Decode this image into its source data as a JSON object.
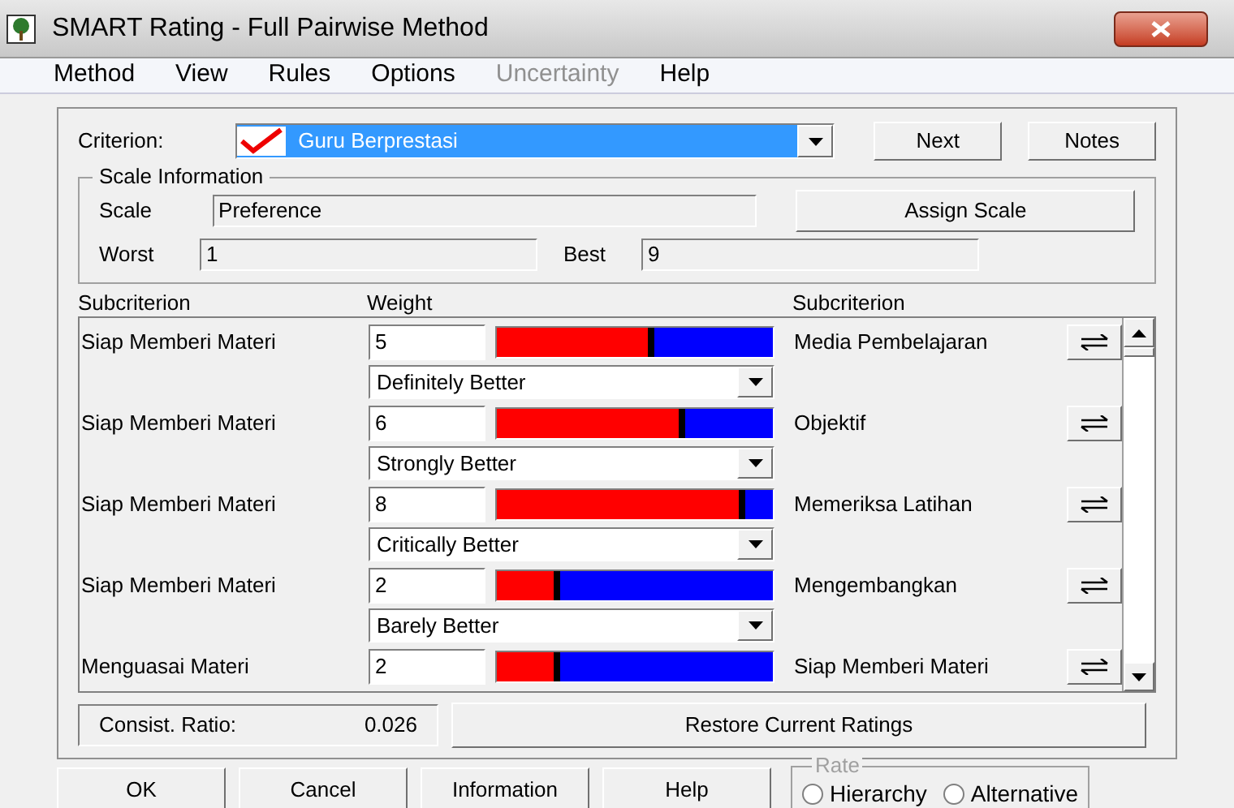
{
  "window": {
    "title": "SMART Rating - Full Pairwise Method"
  },
  "menu": [
    {
      "label": "Method",
      "disabled": false
    },
    {
      "label": "View",
      "disabled": false
    },
    {
      "label": "Rules",
      "disabled": false
    },
    {
      "label": "Options",
      "disabled": false
    },
    {
      "label": "Uncertainty",
      "disabled": true
    },
    {
      "label": "Help",
      "disabled": false
    }
  ],
  "criterion": {
    "label": "Criterion:",
    "value": "Guru Berprestasi"
  },
  "top_buttons": [
    "Next",
    "Notes"
  ],
  "scale_information": {
    "title": "Scale Information",
    "scale_label": "Scale",
    "scale": "Preference",
    "assign_button": "Assign Scale",
    "worst_label": "Worst",
    "worst": "1",
    "best_label": "Best",
    "best": "9"
  },
  "table": {
    "columns": [
      "Subcriterion",
      "Weight",
      "Subcriterion"
    ],
    "rows": [
      {
        "left": "Siap Memberi Materi",
        "weight": "5",
        "level": 0.57,
        "verbal": "Definitely Better",
        "right": "Media Pembelajaran"
      },
      {
        "left": "Siap Memberi Materi",
        "weight": "6",
        "level": 0.68,
        "verbal": "Strongly Better",
        "right": "Objektif"
      },
      {
        "left": "Siap Memberi Materi",
        "weight": "8",
        "level": 0.9,
        "verbal": "Critically Better",
        "right": "Memeriksa Latihan"
      },
      {
        "left": "Siap Memberi Materi",
        "weight": "2",
        "level": 0.23,
        "verbal": "Barely Better",
        "right": "Mengembangkan"
      },
      {
        "left": "Menguasai Materi",
        "weight": "2",
        "level": 0.23,
        "right": "Siap Memberi Materi"
      }
    ]
  },
  "consistency": {
    "label": "Consist. Ratio:",
    "value": "0.026"
  },
  "restore_button": "Restore Current Ratings",
  "bottom_buttons": [
    "OK",
    "Cancel",
    "Information",
    "Help"
  ],
  "rate": {
    "title": "Rate",
    "options": [
      {
        "label": "Hierarchy",
        "selected": false
      },
      {
        "label": "Alternative",
        "selected": false
      }
    ]
  }
}
